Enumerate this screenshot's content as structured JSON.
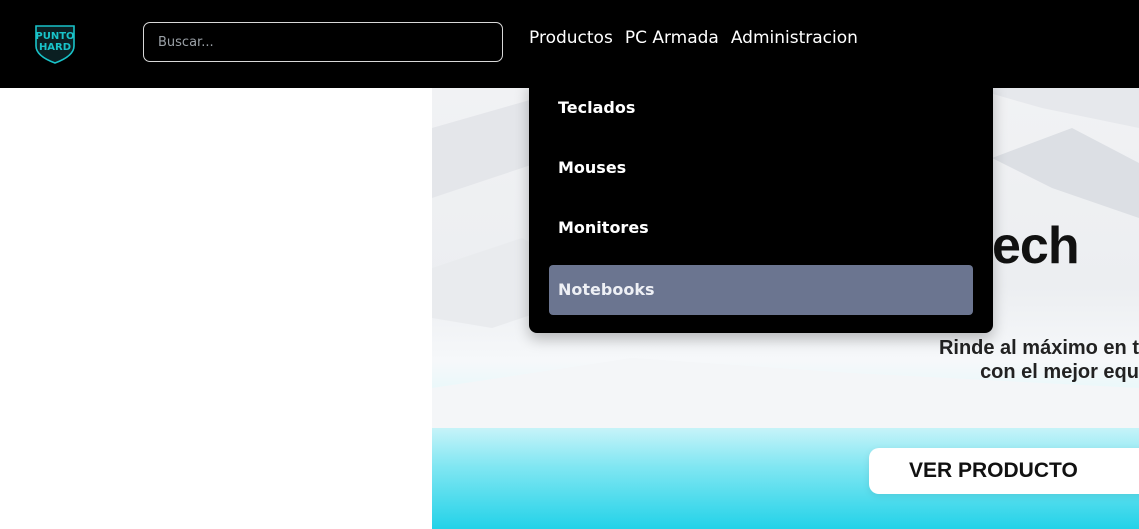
{
  "header": {
    "logo": {
      "line1": "PUNTO",
      "line2": "HARD",
      "icon": "punto-hard-shield-logo",
      "color": "#19c3c9"
    },
    "search": {
      "placeholder": "Buscar...",
      "value": ""
    },
    "nav": [
      {
        "label": "Productos"
      },
      {
        "label": "PC Armada"
      },
      {
        "label": "Administracion"
      }
    ]
  },
  "dropdown": {
    "items": [
      {
        "label": "Teclados"
      },
      {
        "label": "Mouses"
      },
      {
        "label": "Monitores"
      },
      {
        "label": "Notebooks"
      }
    ],
    "active_index": 3,
    "active_color": "#6b7590"
  },
  "hero": {
    "title": "ech",
    "subtitle_line1": "Rinde al máximo en t",
    "subtitle_line2": "con el mejor equ",
    "cta_label": "VER PRODUCTO",
    "accent_color": "#23d2e8"
  }
}
